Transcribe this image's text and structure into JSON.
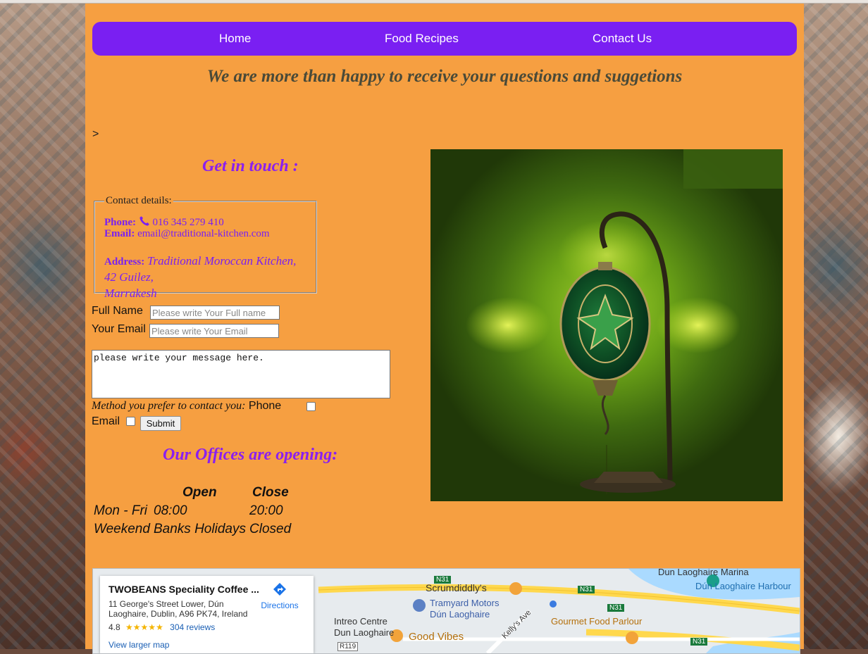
{
  "nav": {
    "home": "Home",
    "recipes": "Food Recipes",
    "contact": "Contact Us"
  },
  "headline": "We are more than happy to receive your questions and suggetions",
  "stray_text": ">",
  "get_in_touch": "Get in touch :",
  "contact_details": {
    "legend": "Contact details:",
    "phone_label": "Phone:",
    "phone": "016 345 279 410",
    "email_label": "Email:",
    "email": "email@traditional-kitchen.com",
    "address_label": "Address:",
    "address_line1": "Traditional Moroccan Kitchen,",
    "address_line2": "42 Guilez,",
    "address_line3": "Marrakesh"
  },
  "form": {
    "full_name_label": "Full Name",
    "full_name_placeholder": "Please write Your Full name",
    "email_label": "Your Email",
    "email_placeholder": "Please write Your Email",
    "message": "please write your message here.",
    "method_label": "Method you prefer to contact you:",
    "phone_option": "Phone",
    "email_option": "Email",
    "submit": "Submit"
  },
  "offices": {
    "title": "Our Offices are opening:",
    "head_open": "Open",
    "head_close": "Close",
    "row1_day": "Mon - Fri",
    "row1_open": "08:00",
    "row1_close": "20:00",
    "row2_day": "Weekend",
    "row2_open": "Banks Holidays",
    "row2_close": "Closed"
  },
  "map": {
    "place_name": "TWOBEANS Speciality Coffee ...",
    "place_address": "11 George's Street Lower, Dún Laoghaire, Dublin, A96 PK74, Ireland",
    "rating": "4.8",
    "stars": "★★★★★",
    "reviews": "304 reviews",
    "view_larger": "View larger map",
    "directions": "Directions",
    "labels": {
      "marina": "Dun Laoghaire Marina",
      "harbour": "Dún Laoghaire Harbour",
      "scrumdiddly": "Scrumdiddly's",
      "tramyard1": "Tramyard Motors",
      "tramyard2": "Dún Laoghaire",
      "intreo1": "Intreo Centre",
      "intreo2": "Dun Laoghaire",
      "goodvibes": "Good Vibes",
      "gourmet": "Gourmet Food Parlour",
      "kellys": "Kelly's Ave",
      "n31a": "N31",
      "n31b": "N31",
      "n31c": "N31",
      "n31d": "N31",
      "r119": "R119"
    }
  },
  "colors": {
    "page_bg": "#f69f41",
    "nav_bg": "#7a1ff2",
    "accent_text": "#8a1ff0"
  }
}
